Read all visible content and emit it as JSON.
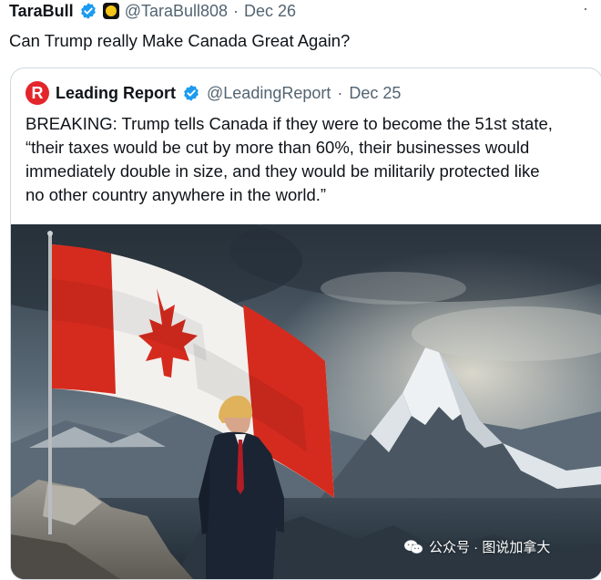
{
  "tweet": {
    "author_name": "TaraBull",
    "handle": "@TaraBull808",
    "separator": "·",
    "date": "Dec 26",
    "text": "Can Trump really Make Canada Great Again?",
    "more": "·"
  },
  "quote": {
    "logo_letter": "R",
    "author_name": "Leading Report",
    "handle": "@LeadingReport",
    "separator": "·",
    "date": "Dec 25",
    "lines": [
      "BREAKING: Trump tells Canada if they were to become the 51st state,",
      "“their taxes would be cut by more than 60%, their businesses would",
      "immediately double in size, and they would be militarily protected like",
      "no other country anywhere in the world.”"
    ]
  },
  "watermark": {
    "text": "公众号 · 图说加拿大"
  },
  "colors": {
    "verified": "#1d9bf0",
    "leading_report_red": "#e3262b",
    "flag_red": "#d52b1e",
    "text_gray": "#536471",
    "border": "#cfd9de"
  },
  "icons": [
    "verified-badge-icon",
    "coin-emoji-icon",
    "leading-report-logo-icon",
    "wechat-icon"
  ]
}
